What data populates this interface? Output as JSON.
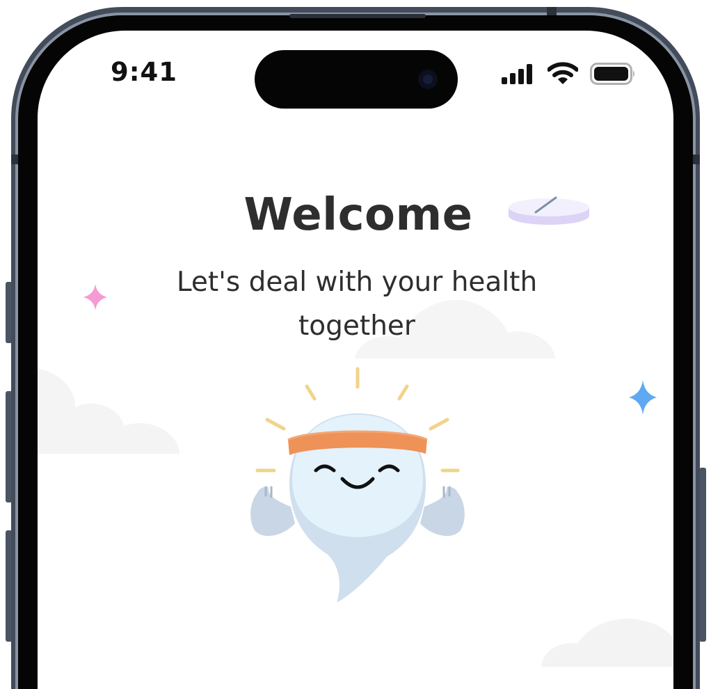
{
  "status_bar": {
    "time": "9:41",
    "icons": [
      "cellular-signal-icon",
      "wifi-icon",
      "battery-icon"
    ]
  },
  "welcome": {
    "title": "Welcome",
    "subtitle": "Let's deal with your health together"
  },
  "colors": {
    "frame": "#3f4858",
    "bezel": "#000000",
    "text": "#2e2e2e",
    "headband": "#ee9257",
    "mascot_body": "#e4f2fc",
    "sparkle_pink": "#f59ad4",
    "sparkle_blue": "#5fa8f2",
    "sun_ray": "#f0d48a",
    "pill": "#ded6f8"
  }
}
